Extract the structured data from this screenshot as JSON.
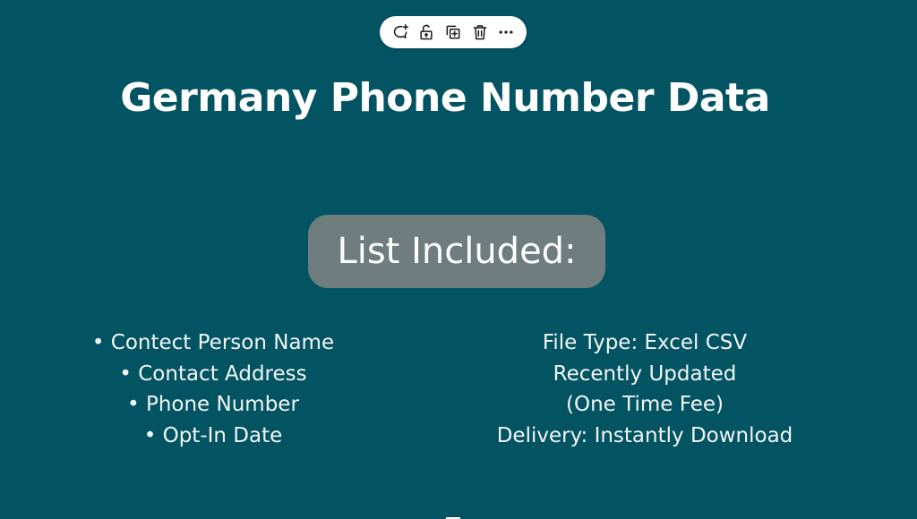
{
  "toolbar": {
    "buttons": [
      {
        "name": "add-comment",
        "icon": "comment-plus-icon"
      },
      {
        "name": "lock",
        "icon": "unlock-icon"
      },
      {
        "name": "duplicate",
        "icon": "duplicate-icon"
      },
      {
        "name": "delete",
        "icon": "trash-icon"
      },
      {
        "name": "more",
        "icon": "more-horizontal-icon"
      }
    ]
  },
  "slide": {
    "title": "Germany Phone Number Data",
    "badge_label": "List Included:",
    "left_items": [
      "• Contect Person Name",
      "• Contact Address",
      "• Phone Number",
      "• Opt-In Date"
    ],
    "right_items": [
      "File Type: Excel CSV",
      "Recently Updated",
      "(One Time Fee)",
      "Delivery: Instantly Download"
    ]
  },
  "colors": {
    "background": "#035462",
    "badge": "#6f7d7e",
    "text": "#ffffff"
  }
}
